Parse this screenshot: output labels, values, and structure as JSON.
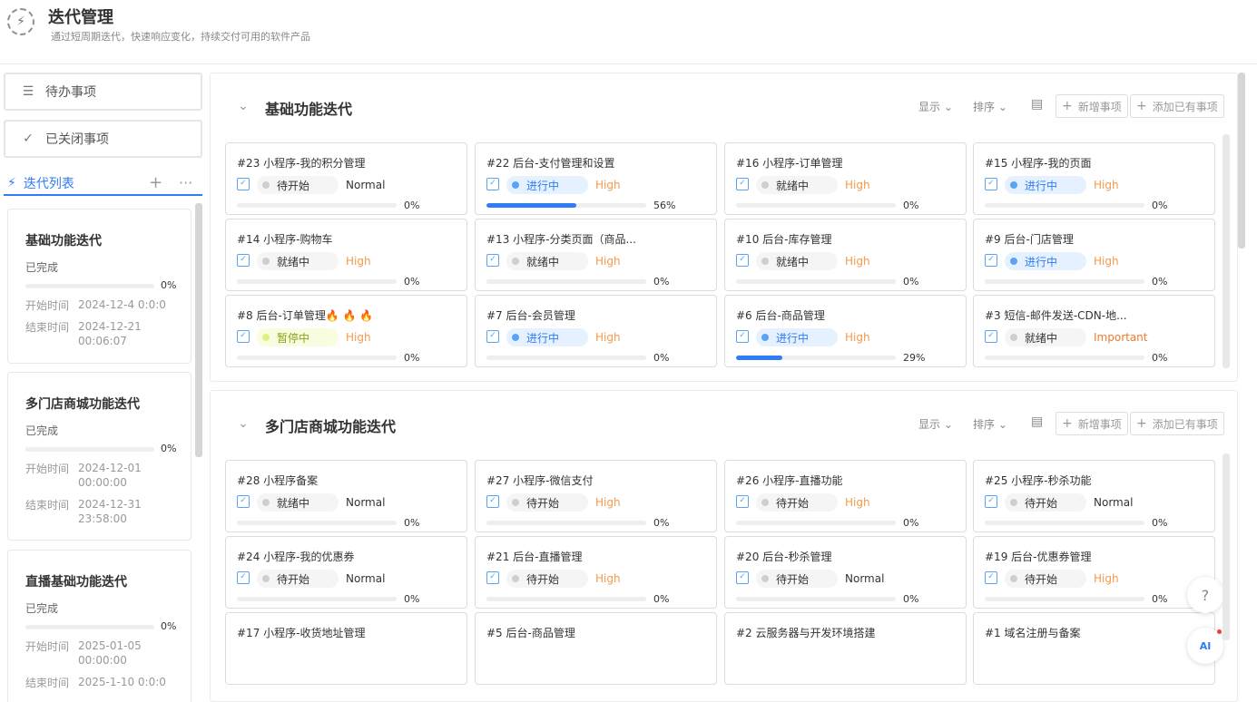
{
  "header": {
    "title": "迭代管理",
    "subtitle": "通过短周期迭代，快速响应变化，持续交付可用的软件产品"
  },
  "sidebar": {
    "todo_label": "待办事项",
    "closed_label": "已关闭事项",
    "iter_list_label": "迭代列表",
    "iterations": [
      {
        "name": "基础功能迭代",
        "status": "已完成",
        "progress": 0,
        "progress_text": "0%",
        "start_label": "开始时间",
        "start": "2024-12-4 0:0:0",
        "end_label": "结束时间",
        "end": "2024-12-21 00:06:07"
      },
      {
        "name": "多门店商城功能迭代",
        "status": "已完成",
        "progress": 0,
        "progress_text": "0%",
        "start_label": "开始时间",
        "start": "2024-12-01 00:00:00",
        "end_label": "结束时间",
        "end": "2024-12-31 23:58:00"
      },
      {
        "name": "直播基础功能迭代",
        "status": "已完成",
        "progress": 0,
        "progress_text": "0%",
        "start_label": "开始时间",
        "start": "2025-01-05 00:00:00",
        "end_label": "结束时间",
        "end": "2025-1-10 0:0:0"
      }
    ]
  },
  "toolbar": {
    "display_label": "显示",
    "sort_label": "排序",
    "add_item_label": "新增事项",
    "add_existing_label": "添加已有事项"
  },
  "panels": [
    {
      "name": "基础功能迭代",
      "items": [
        {
          "title": "#23 小程序-我的积分管理",
          "state": "待开始",
          "state_type": "idle",
          "priority": "Normal",
          "priority_type": "normal",
          "progress": 0,
          "progress_text": "0%"
        },
        {
          "title": "#22 后台-支付管理和设置",
          "state": "进行中",
          "state_type": "run",
          "priority": "High",
          "priority_type": "high",
          "progress": 56,
          "progress_text": "56%"
        },
        {
          "title": "#16 小程序-订单管理",
          "state": "就绪中",
          "state_type": "idle",
          "priority": "High",
          "priority_type": "high",
          "progress": 0,
          "progress_text": "0%"
        },
        {
          "title": "#15 小程序-我的页面",
          "state": "进行中",
          "state_type": "run",
          "priority": "High",
          "priority_type": "high",
          "progress": 0,
          "progress_text": "0%"
        },
        {
          "title": "#14 小程序-购物车",
          "state": "就绪中",
          "state_type": "idle",
          "priority": "High",
          "priority_type": "high",
          "progress": 0,
          "progress_text": "0%"
        },
        {
          "title": "#13 小程序-分类页面（商品...",
          "state": "就绪中",
          "state_type": "idle",
          "priority": "High",
          "priority_type": "high",
          "progress": 0,
          "progress_text": "0%"
        },
        {
          "title": "#10 后台-库存管理",
          "state": "就绪中",
          "state_type": "idle",
          "priority": "High",
          "priority_type": "high",
          "progress": 0,
          "progress_text": "0%"
        },
        {
          "title": "#9 后台-门店管理",
          "state": "进行中",
          "state_type": "run",
          "priority": "High",
          "priority_type": "high",
          "progress": 0,
          "progress_text": "0%"
        },
        {
          "title": "#8 后台-订单管理🔥 🔥 🔥",
          "state": "暂停中",
          "state_type": "pause",
          "priority": "High",
          "priority_type": "high",
          "progress": 0,
          "progress_text": "0%"
        },
        {
          "title": "#7 后台-会员管理",
          "state": "进行中",
          "state_type": "run",
          "priority": "High",
          "priority_type": "high",
          "progress": 0,
          "progress_text": "0%"
        },
        {
          "title": "#6 后台-商品管理",
          "state": "进行中",
          "state_type": "run",
          "priority": "High",
          "priority_type": "high",
          "progress": 29,
          "progress_text": "29%"
        },
        {
          "title": "#3 短信-邮件发送-CDN-地...",
          "state": "就绪中",
          "state_type": "idle",
          "priority": "Important",
          "priority_type": "important",
          "progress": 0,
          "progress_text": "0%"
        }
      ]
    },
    {
      "name": "多门店商城功能迭代",
      "items": [
        {
          "title": "#28 小程序备案",
          "state": "就绪中",
          "state_type": "idle",
          "priority": "Normal",
          "priority_type": "normal",
          "progress": 0,
          "progress_text": "0%"
        },
        {
          "title": "#27 小程序-微信支付",
          "state": "待开始",
          "state_type": "idle",
          "priority": "High",
          "priority_type": "high",
          "progress": 0,
          "progress_text": "0%"
        },
        {
          "title": "#26 小程序-直播功能",
          "state": "待开始",
          "state_type": "idle",
          "priority": "High",
          "priority_type": "high",
          "progress": 0,
          "progress_text": "0%"
        },
        {
          "title": "#25 小程序-秒杀功能",
          "state": "待开始",
          "state_type": "idle",
          "priority": "Normal",
          "priority_type": "normal",
          "progress": 0,
          "progress_text": "0%"
        },
        {
          "title": "#24 小程序-我的优惠券",
          "state": "待开始",
          "state_type": "idle",
          "priority": "Normal",
          "priority_type": "normal",
          "progress": 0,
          "progress_text": "0%"
        },
        {
          "title": "#21 后台-直播管理",
          "state": "待开始",
          "state_type": "idle",
          "priority": "High",
          "priority_type": "high",
          "progress": 0,
          "progress_text": "0%"
        },
        {
          "title": "#20 后台-秒杀管理",
          "state": "待开始",
          "state_type": "idle",
          "priority": "Normal",
          "priority_type": "normal",
          "progress": 0,
          "progress_text": "0%"
        },
        {
          "title": "#19 后台-优惠券管理",
          "state": "待开始",
          "state_type": "idle",
          "priority": "High",
          "priority_type": "high",
          "progress": 0,
          "progress_text": "0%"
        },
        {
          "title": "#17 小程序-收货地址管理",
          "state": "",
          "state_type": "hidden",
          "priority": "",
          "priority_type": "hidden",
          "progress": 0,
          "progress_text": ""
        },
        {
          "title": "#5 后台-商品管理",
          "state": "",
          "state_type": "hidden",
          "priority": "",
          "priority_type": "hidden",
          "progress": 0,
          "progress_text": ""
        },
        {
          "title": "#2 云服务器与开发环境搭建",
          "state": "",
          "state_type": "hidden",
          "priority": "",
          "priority_type": "hidden",
          "progress": 0,
          "progress_text": ""
        },
        {
          "title": "#1 域名注册与备案",
          "state": "",
          "state_type": "hidden",
          "priority": "",
          "priority_type": "hidden",
          "progress": 0,
          "progress_text": ""
        }
      ]
    }
  ],
  "floating": {
    "help_icon": "question-circle-icon",
    "ai_label": "AI"
  },
  "colors": {
    "accent": "#2f7cf6",
    "high": "#f39a4a",
    "important": "#f07b2c"
  }
}
